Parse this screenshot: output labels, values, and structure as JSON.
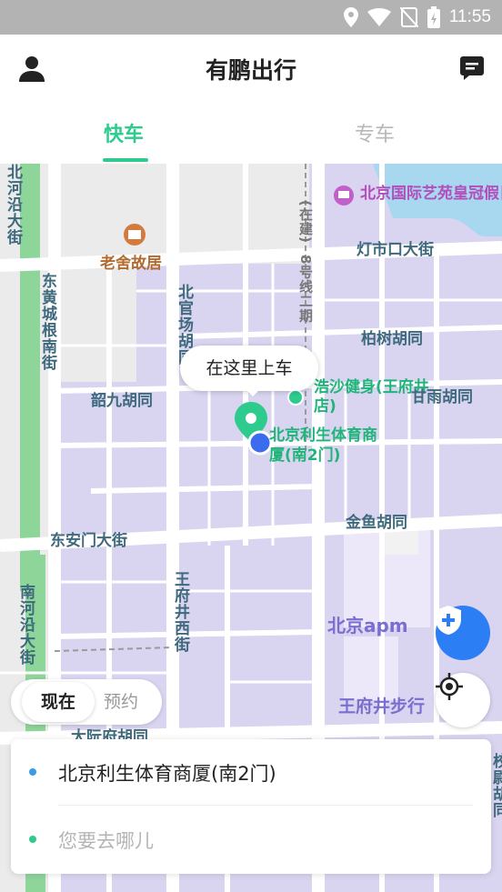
{
  "status_bar": {
    "time": "11:55",
    "icons": [
      "location-icon",
      "wifi-icon",
      "no-sim-icon",
      "battery-charging-icon"
    ]
  },
  "header": {
    "title": "有鹏出行",
    "left_icon": "user-icon",
    "right_icon": "message-icon"
  },
  "tabs": [
    {
      "label": "快车",
      "active": true
    },
    {
      "label": "专车",
      "active": false
    }
  ],
  "map": {
    "pickup_bubble": "在这里上车",
    "labels": {
      "hotel": "北京国际艺苑皇冠假日酒店",
      "museum": "老舍故居",
      "dengshikou": "灯市口大街",
      "zaijian": "(在建)",
      "line8": "8号线二期",
      "beiheyan": "北河沿大街",
      "donghuang": "东黄城根南街",
      "beiguan": "北官场胡同",
      "baishu": "柏树胡同",
      "shaojiu": "韶九胡同",
      "haosha": "浩沙健身(王府井店)",
      "nanhu": "甘雨胡同",
      "lisheng": "北京利生体育商厦(南2门)",
      "jinyu": "金鱼胡同",
      "dongan": "东安门大街",
      "nanheyan": "南河沿大街",
      "wangfujingxi": "王府井西街",
      "apm": "北京apm",
      "wangfujing_walk": "王府井步行",
      "dajifu": "大阮府胡同",
      "right_edge": "校尉胡同"
    }
  },
  "time_switch": {
    "now": "现在",
    "reserve": "预约"
  },
  "address_card": {
    "pickup": "北京利生体育商厦(南2门)",
    "destination_placeholder": "您要去哪儿"
  },
  "colors": {
    "accent_green": "#2ecb8e",
    "fab_blue": "#2c7ef5",
    "pickup_dot": "#3b9be8",
    "destination_dot": "#2ecb8e"
  }
}
